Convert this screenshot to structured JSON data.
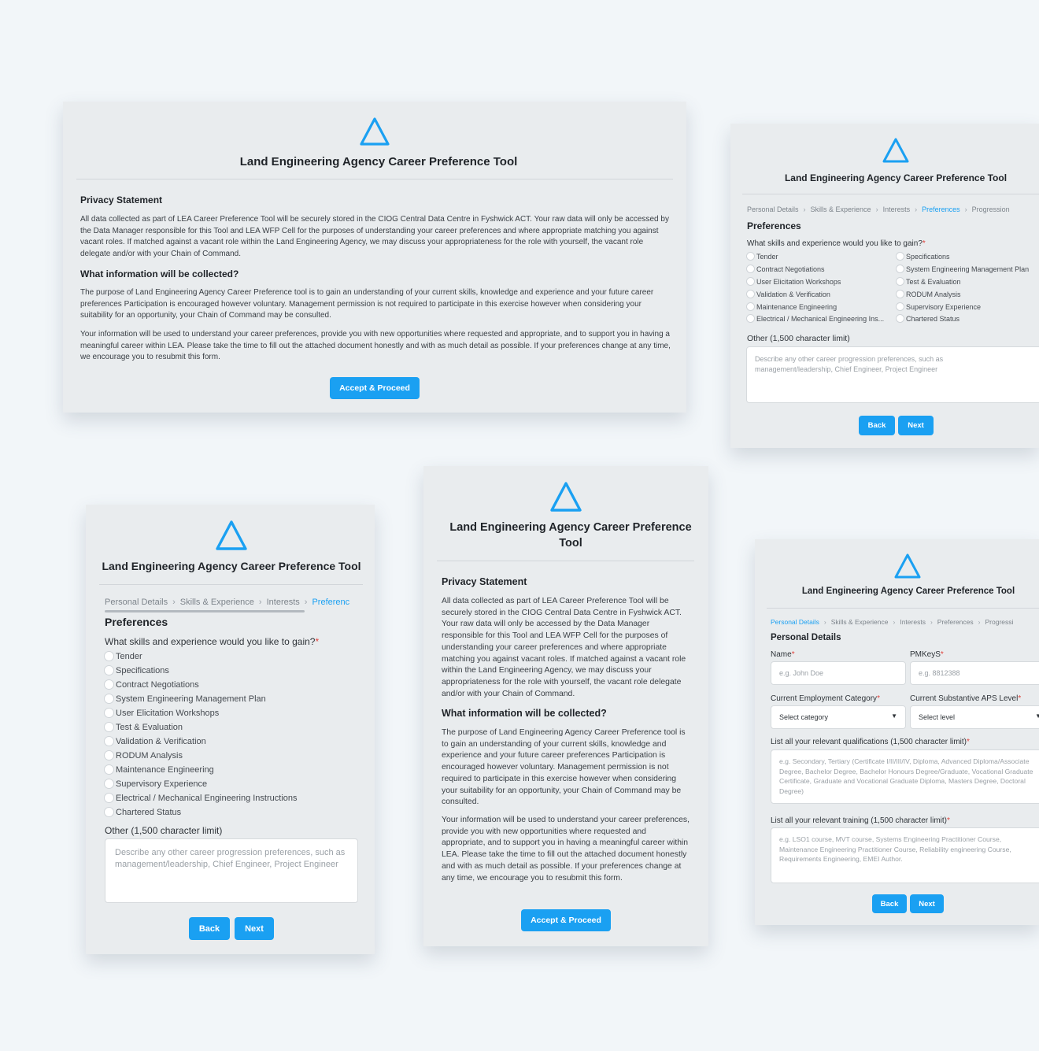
{
  "app_title": "Land Engineering Agency Career Preference Tool",
  "app_title_wrapped": [
    "Land Engineering Agency Career Preference",
    "Tool"
  ],
  "privacy": {
    "heading": "Privacy Statement",
    "body": "All data collected as part of LEA Career Preference Tool will be securely stored in the CIOG Central Data Centre in Fyshwick ACT. Your raw data will only be accessed by the Data Manager responsible for this Tool and LEA WFP Cell for the purposes of understanding your career preferences and where appropriate matching you against vacant roles. If matched against a vacant role within the Land Engineering Agency, we may discuss your appropriateness for the role with yourself, the vacant role delegate and/or with your Chain of Command.",
    "collected_heading": "What information will be collected?",
    "collected_body_1": "The purpose of Land Engineering Agency Career Preference tool is to gain an understanding of your current skills, knowledge and experience and your future career preferences Participation is encouraged however voluntary. Management permission is not required to participate in this exercise however when considering your suitability for an opportunity, your Chain of Command may be consulted.",
    "collected_body_2": "Your information will be used to understand your career preferences, provide you with new opportunities where requested and appropriate, and to support you in having a meaningful career within LEA. Please take the time to fill out the attached document honestly and with as much detail as possible. If your preferences change at any time, we encourage you to resubmit this form.",
    "accept_label": "Accept & Proceed"
  },
  "breadcrumb": [
    "Personal Details",
    "Skills & Experience",
    "Interests",
    "Preferences",
    "Progression"
  ],
  "breadcrumb_short_last": "Preferenc",
  "breadcrumb_short_prog": "Progressi",
  "preferences": {
    "heading": "Preferences",
    "question": "What skills and experience would you like to gain?",
    "options": [
      "Tender",
      "Specifications",
      "Contract Negotiations",
      "System Engineering Management Plan",
      "User Elicitation Workshops",
      "Test & Evaluation",
      "Validation & Verification",
      "RODUM Analysis",
      "Maintenance Engineering",
      "Supervisory Experience",
      "Electrical / Mechanical Engineering Instructions",
      "Chartered Status"
    ],
    "truncated_electrical": "Electrical / Mechanical Engineering Ins...",
    "other_label": "Other (1,500 character limit)",
    "other_placeholder": "Describe any other career progression preferences, such as management/leadership, Chief Engineer, Project Engineer"
  },
  "nav": {
    "back": "Back",
    "next": "Next"
  },
  "personal": {
    "heading": "Personal Details",
    "name_label": "Name",
    "name_placeholder": "e.g. John Doe",
    "pmkeys_label": "PMKeyS",
    "pmkeys_placeholder": "e.g. 8812388",
    "category_label": "Current Employment Category",
    "category_value": "Select category",
    "aps_label": "Current Substantive APS Level",
    "aps_value": "Select level",
    "qual_label": "List all your relevant qualifications (1,500 character limit)",
    "qual_placeholder": "e.g. Secondary, Tertiary (Certificate I/II/III/IV, Diploma, Advanced Diploma/Associate Degree, Bachelor Degree, Bachelor Honours Degree/Graduate, Vocational Graduate Certificate, Graduate and Vocational Graduate Diploma, Masters Degree, Doctoral Degree)",
    "training_label": "List all your relevant training (1,500 character limit)",
    "training_placeholder": "e.g. LSO1 course, MVT course, Systems Engineering Practitioner Course, Maintenance Engineering Practitioner Course, Reliability engineering Course, Requirements Engineering, EMEI Author."
  },
  "required_mark": "*",
  "colors": {
    "accent": "#1aa0f2",
    "card": "#e9ecee",
    "background": "#f2f6f9",
    "required": "#e0443e"
  },
  "icons": {
    "logo": "triangle-logo-icon",
    "dropdown": "caret-down-icon",
    "breadcrumb_separator": "chevron-right-icon"
  }
}
